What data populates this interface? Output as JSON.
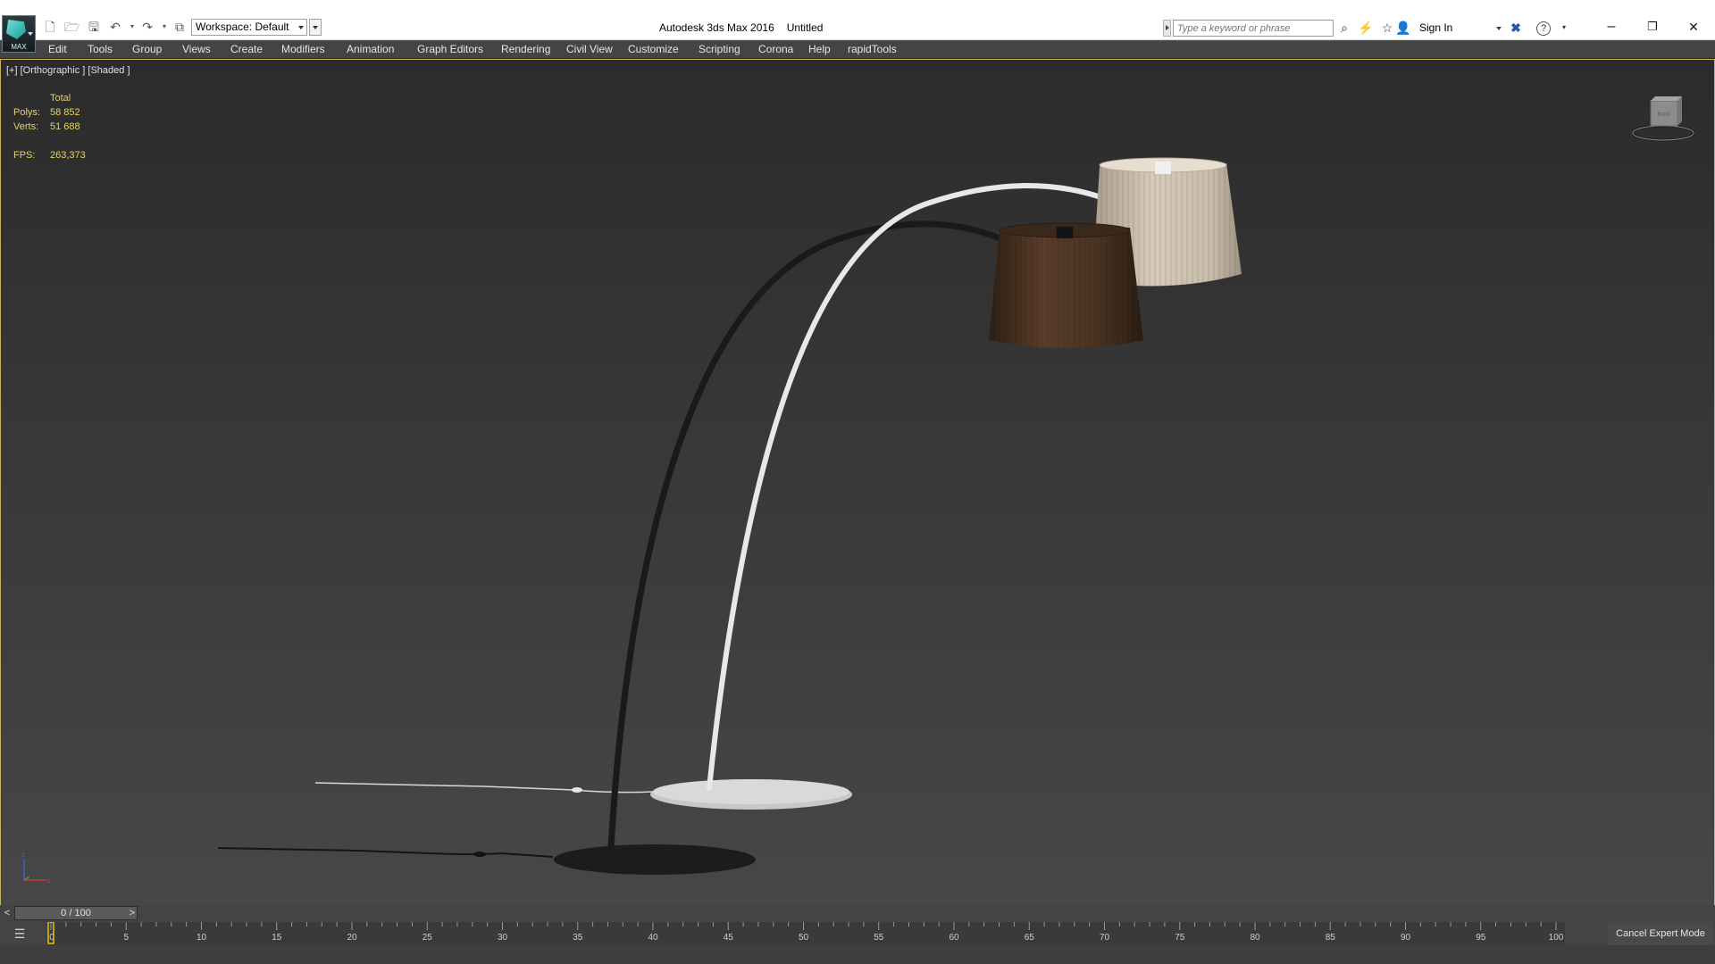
{
  "app": {
    "logo_text": "MAX",
    "name": "Autodesk 3ds Max 2016",
    "document": "Untitled",
    "workspace": "Workspace: Default"
  },
  "quick_access": [
    "new-file-icon",
    "open-file-icon",
    "save-icon",
    "undo-icon",
    "redo-icon",
    "project-folder-icon"
  ],
  "infocenter": {
    "search_placeholder": "Type a keyword or phrase",
    "sign_in": "Sign In",
    "icons": [
      "binoculars-icon",
      "subscription-icon",
      "favorites-star-icon",
      "user-icon",
      "exchange-x-icon",
      "help-icon"
    ]
  },
  "window_controls": {
    "minimize": "–",
    "restore": "❐",
    "close": "✕"
  },
  "menu": [
    "Edit",
    "Tools",
    "Group",
    "Views",
    "Create",
    "Modifiers",
    "Animation",
    "Graph Editors",
    "Rendering",
    "Civil View",
    "Customize",
    "Scripting",
    "Corona",
    "Help",
    "rapidTools"
  ],
  "viewport": {
    "label": "[+] [Orthographic ] [Shaded ]",
    "stats": {
      "header": "Total",
      "polys_label": "Polys:",
      "polys": "58 852",
      "verts_label": "Verts:",
      "verts": "51 688",
      "fps_label": "FPS:",
      "fps": "263,373"
    },
    "viewcube_label": "front",
    "colors": {
      "border": "#c9b35a",
      "stats": "#e7d26b",
      "dark_shade": "#4a3323",
      "light_shade": "#c9bcaa"
    }
  },
  "timeline": {
    "prev": "<",
    "next": ">",
    "frame": "0 / 100",
    "ticks": [
      "0",
      "5",
      "10",
      "15",
      "20",
      "25",
      "30",
      "35",
      "40",
      "45",
      "50",
      "55",
      "60",
      "65",
      "70",
      "75",
      "80",
      "85",
      "90",
      "95",
      "100"
    ]
  },
  "cancel_expert": "Cancel Expert Mode"
}
